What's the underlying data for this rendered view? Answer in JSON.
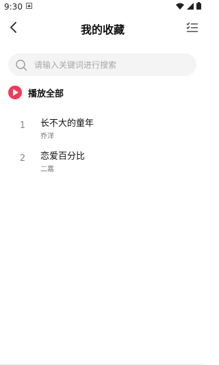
{
  "status_bar": {
    "time": "9:30"
  },
  "header": {
    "title": "我的收藏"
  },
  "search": {
    "placeholder": "请输入关键词进行搜索"
  },
  "play_all": {
    "label": "播放全部"
  },
  "songs": [
    {
      "index": "1",
      "title": "长不大的童年",
      "artist": "乔洋"
    },
    {
      "index": "2",
      "title": "恋爱百分比",
      "artist": "二嘉"
    }
  ],
  "icons": {
    "back": "chevron-left-icon",
    "manage": "checklist-icon",
    "search": "search-icon",
    "play": "play-circle-icon"
  },
  "colors": {
    "accent": "#f23a5a",
    "search_bg": "#f4f4f4"
  }
}
